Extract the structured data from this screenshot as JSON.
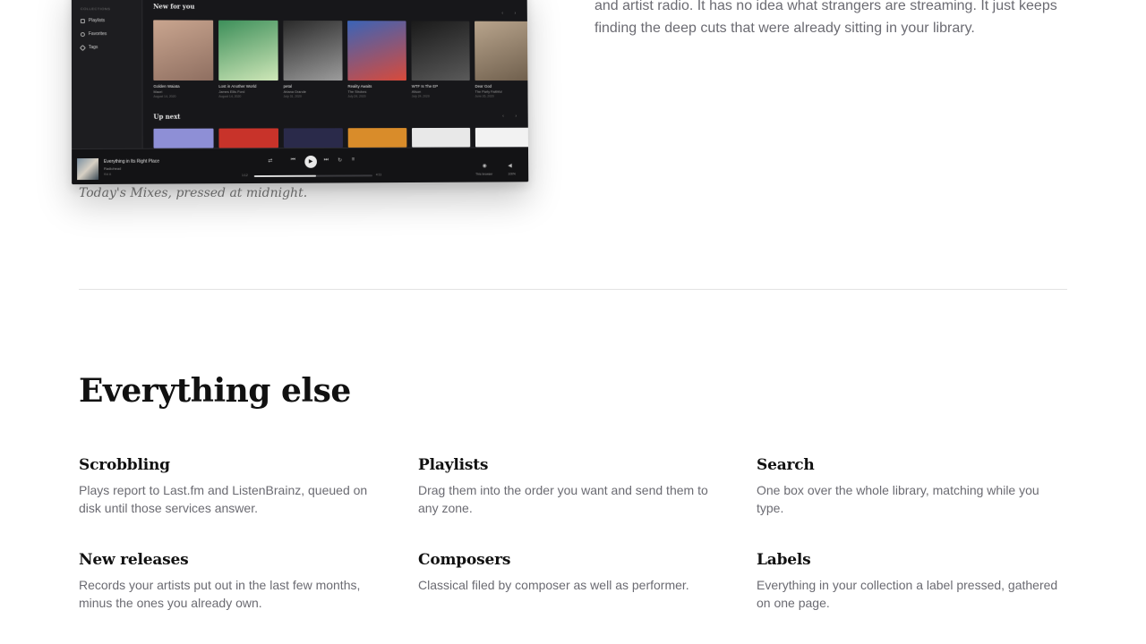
{
  "screenshot": {
    "sidebar": {
      "heading": "COLLECTIONS",
      "items": [
        "Playlists",
        "Favorites",
        "Tags"
      ]
    },
    "new_for_you": {
      "title": "New for you",
      "albums": [
        {
          "title": "Golden Waiata",
          "artist": "Maori",
          "date": "August 14, 2020",
          "cover_colors": [
            "#c9a58f",
            "#8f6f61"
          ]
        },
        {
          "title": "Lost in Another World",
          "artist": "James Ellis Ford",
          "date": "August 14, 2020",
          "cover_colors": [
            "#3d8f5a",
            "#cfe7b8"
          ]
        },
        {
          "title": "petal",
          "artist": "Ariana Grande",
          "date": "July 31, 2020",
          "cover_colors": [
            "#2a2a2a",
            "#9c9c9c"
          ]
        },
        {
          "title": "Reality Awaits",
          "artist": "The Strokes",
          "date": "July 24, 2020",
          "cover_colors": [
            "#3a64b8",
            "#d94a3a"
          ]
        },
        {
          "title": "WTF Is The EP",
          "artist": "Alison",
          "date": "July 24, 2020",
          "cover_colors": [
            "#1a1a1a",
            "#5a5a5a"
          ]
        },
        {
          "title": "Dear God",
          "artist": "The Party Faithful",
          "date": "June 26, 2020",
          "cover_colors": [
            "#b8a48c",
            "#6e5e4c"
          ]
        }
      ]
    },
    "up_next": {
      "title": "Up next",
      "cover_colors": [
        "#8e8fd6",
        "#c8332a",
        "#2a2a4a",
        "#d98c2a",
        "#e8e8e8",
        "#f2f2f2"
      ]
    },
    "player": {
      "track": "Everything in Its Right Place",
      "artist": "Radiohead",
      "album": "Kid A",
      "elapsed": "1:12",
      "duration": "4:11",
      "progress": 0.52,
      "zone_label": "This browser",
      "volume_label": "100%"
    }
  },
  "caption": "Today's Mixes, pressed at midnight.",
  "intro_text": "and artist radio. It has no idea what strangers are streaming. It just keeps finding the deep cuts that were already sitting in your library.",
  "everything_else": {
    "heading": "Everything else",
    "features": [
      {
        "title": "Scrobbling",
        "body": "Plays report to Last.fm and ListenBrainz, queued on disk until those services answer."
      },
      {
        "title": "Playlists",
        "body": "Drag them into the order you want and send them to any zone."
      },
      {
        "title": "Search",
        "body": "One box over the whole library, matching while you type."
      },
      {
        "title": "New releases",
        "body": "Records your artists put out in the last few months, minus the ones you already own."
      },
      {
        "title": "Composers",
        "body": "Classical filed by composer as well as performer."
      },
      {
        "title": "Labels",
        "body": "Everything in your collection a label pressed, gathered on one page."
      }
    ]
  }
}
